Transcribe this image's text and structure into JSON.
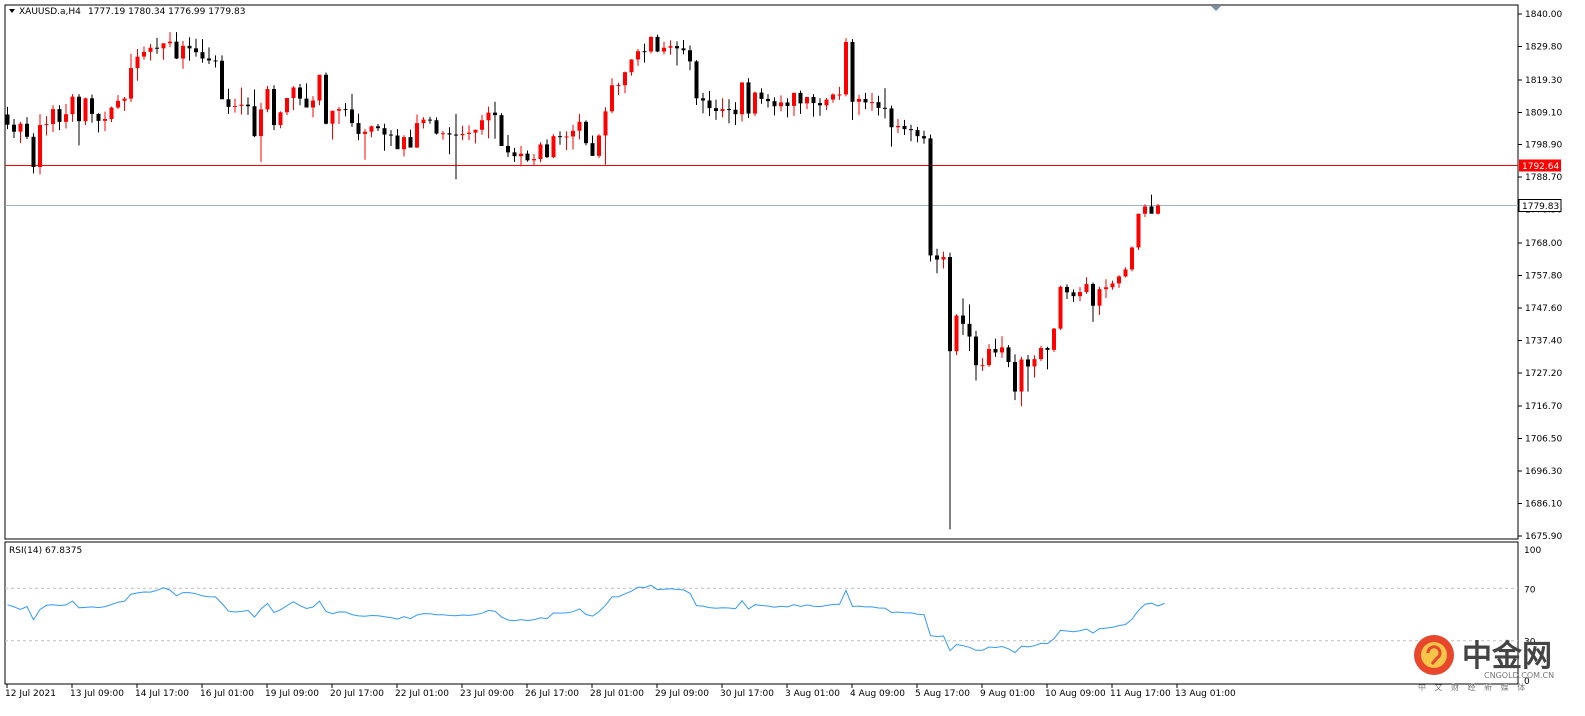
{
  "header": {
    "symbol": "XAUUSD.a,H4",
    "ohlc": "1777.19 1780.34 1776.99 1779.83"
  },
  "price_lines": {
    "resistance": {
      "value": 1792.64,
      "label": "1792.64",
      "color": "#ff0000"
    },
    "current": {
      "value": 1779.83,
      "label": "1779.83",
      "color": "#9fb1c5"
    }
  },
  "colors": {
    "bull": "#ff0000",
    "bear": "#000000",
    "rsi": "#3399ff",
    "frame": "#000000",
    "level": "#c0c0c0"
  },
  "rsi": {
    "label": "RSI(14) 67.8375",
    "scale_labels": [
      "100",
      "70",
      "30",
      "0"
    ],
    "levels": [
      30,
      70
    ]
  },
  "watermark": {
    "cn": "中金网",
    "url": "CNGOLD.COM.CN",
    "sub": "中 文 财 经 新 媒 体"
  },
  "chart_data": {
    "type": "candlestick",
    "title": "XAUUSD.a,H4",
    "ylim": [
      1675.9,
      1840.0
    ],
    "ytick_values": [
      1840.0,
      1829.8,
      1819.3,
      1809.1,
      1798.9,
      1788.7,
      1778.5,
      1768.0,
      1757.8,
      1747.6,
      1737.4,
      1727.2,
      1716.7,
      1706.5,
      1696.3,
      1686.1,
      1675.9
    ],
    "ytick_labels": [
      "1840.00",
      "1829.80",
      "1819.30",
      "1809.10",
      "1798.90",
      "1788.70",
      "1778.50",
      "1768.00",
      "1757.80",
      "1747.60",
      "1737.40",
      "1727.20",
      "1716.70",
      "1706.50",
      "1696.30",
      "1686.10",
      "1675.90"
    ],
    "xtick_labels": [
      "12 Jul 2021",
      "13 Jul 09:00",
      "14 Jul 17:00",
      "16 Jul 01:00",
      "19 Jul 09:00",
      "20 Jul 17:00",
      "22 Jul 01:00",
      "23 Jul 09:00",
      "26 Jul 17:00",
      "28 Jul 01:00",
      "29 Jul 09:00",
      "30 Jul 17:00",
      "3 Aug 01:00",
      "4 Aug 09:00",
      "5 Aug 17:00",
      "9 Aug 01:00",
      "10 Aug 09:00",
      "11 Aug 17:00",
      "13 Aug 01:00"
    ],
    "xtick_index": [
      0,
      10,
      20,
      30,
      40,
      50,
      60,
      70,
      80,
      90,
      100,
      110,
      120,
      130,
      140,
      150,
      160,
      170,
      180
    ],
    "candles": [
      [
        1808.4,
        1810.8,
        1803.8,
        1805.2
      ],
      [
        1805.2,
        1807.0,
        1801.0,
        1803.0
      ],
      [
        1803.0,
        1806.1,
        1799.4,
        1805.5
      ],
      [
        1805.5,
        1807.6,
        1800.7,
        1801.4
      ],
      [
        1801.4,
        1802.5,
        1789.9,
        1791.9
      ],
      [
        1791.9,
        1808.5,
        1789.6,
        1805.1
      ],
      [
        1805.1,
        1807.9,
        1801.8,
        1805.4
      ],
      [
        1805.4,
        1811.3,
        1802.9,
        1810.1
      ],
      [
        1810.1,
        1811.3,
        1803.5,
        1806.1
      ],
      [
        1806.1,
        1811.7,
        1804.0,
        1808.5
      ],
      [
        1808.5,
        1814.8,
        1806.1,
        1814.0
      ],
      [
        1814.0,
        1814.8,
        1798.7,
        1806.3
      ],
      [
        1806.3,
        1813.7,
        1805.1,
        1813.5
      ],
      [
        1813.5,
        1814.7,
        1805.8,
        1808.6
      ],
      [
        1808.6,
        1808.8,
        1802.8,
        1806.4
      ],
      [
        1806.4,
        1809.3,
        1803.2,
        1807.0
      ],
      [
        1807.0,
        1810.9,
        1806.0,
        1810.6
      ],
      [
        1810.6,
        1814.5,
        1810.1,
        1812.7
      ],
      [
        1812.7,
        1813.9,
        1809.5,
        1813.4
      ],
      [
        1813.4,
        1827.5,
        1812.3,
        1823.0
      ],
      [
        1823.0,
        1829.0,
        1819.0,
        1826.6
      ],
      [
        1826.6,
        1829.8,
        1825.6,
        1828.1
      ],
      [
        1828.1,
        1830.6,
        1825.4,
        1829.4
      ],
      [
        1829.4,
        1832.5,
        1827.5,
        1829.2
      ],
      [
        1829.2,
        1830.6,
        1825.6,
        1830.8
      ],
      [
        1830.8,
        1834.3,
        1829.6,
        1831.3
      ],
      [
        1831.3,
        1834.3,
        1825.8,
        1826.0
      ],
      [
        1826.0,
        1831.5,
        1822.8,
        1830.0
      ],
      [
        1830.0,
        1832.7,
        1825.3,
        1829.2
      ],
      [
        1829.2,
        1832.2,
        1826.6,
        1828.0
      ],
      [
        1828.0,
        1832.1,
        1824.7,
        1826.0
      ],
      [
        1826.0,
        1829.5,
        1824.3,
        1825.4
      ],
      [
        1825.4,
        1827.0,
        1823.2,
        1825.3
      ],
      [
        1825.3,
        1827.0,
        1813.7,
        1813.2
      ],
      [
        1813.2,
        1816.5,
        1808.6,
        1810.8
      ],
      [
        1810.8,
        1813.4,
        1809.0,
        1811.1
      ],
      [
        1811.1,
        1816.9,
        1808.4,
        1811.5
      ],
      [
        1811.5,
        1813.8,
        1808.3,
        1811.0
      ],
      [
        1811.0,
        1816.3,
        1801.3,
        1801.6
      ],
      [
        1801.6,
        1812.1,
        1793.5,
        1810.0
      ],
      [
        1810.0,
        1817.4,
        1809.1,
        1816.4
      ],
      [
        1816.4,
        1817.6,
        1803.5,
        1805.1
      ],
      [
        1805.1,
        1809.4,
        1804.1,
        1809.1
      ],
      [
        1809.1,
        1813.4,
        1808.2,
        1813.6
      ],
      [
        1813.6,
        1817.3,
        1809.8,
        1816.9
      ],
      [
        1816.9,
        1818.0,
        1811.3,
        1813.4
      ],
      [
        1813.4,
        1818.2,
        1811.1,
        1810.6
      ],
      [
        1810.6,
        1814.2,
        1807.5,
        1812.8
      ],
      [
        1812.8,
        1819.9,
        1811.3,
        1820.9
      ],
      [
        1820.9,
        1821.6,
        1805.3,
        1805.5
      ],
      [
        1805.5,
        1806.3,
        1800.5,
        1809.6
      ],
      [
        1809.6,
        1810.8,
        1805.4,
        1810.1
      ],
      [
        1810.1,
        1812.0,
        1807.8,
        1810.0
      ],
      [
        1810.0,
        1814.9,
        1804.5,
        1805.7
      ],
      [
        1805.7,
        1808.7,
        1800.3,
        1802.3
      ],
      [
        1802.3,
        1803.8,
        1794.2,
        1803.0
      ],
      [
        1803.0,
        1804.9,
        1801.2,
        1804.7
      ],
      [
        1804.7,
        1805.4,
        1803.2,
        1804.1
      ],
      [
        1804.1,
        1805.5,
        1797.0,
        1802.1
      ],
      [
        1802.1,
        1803.5,
        1798.5,
        1801.8
      ],
      [
        1801.8,
        1803.8,
        1797.8,
        1797.5
      ],
      [
        1797.5,
        1801.9,
        1795.2,
        1801.3
      ],
      [
        1801.3,
        1803.6,
        1799.6,
        1798.0
      ],
      [
        1798.0,
        1808.4,
        1797.9,
        1805.7
      ],
      [
        1805.7,
        1807.6,
        1804.0,
        1806.8
      ],
      [
        1806.8,
        1807.7,
        1805.5,
        1806.6
      ],
      [
        1806.6,
        1807.5,
        1802.1,
        1802.4
      ],
      [
        1802.4,
        1803.2,
        1800.5,
        1802.5
      ],
      [
        1802.5,
        1804.4,
        1795.9,
        1802.1
      ],
      [
        1802.1,
        1808.6,
        1788.0,
        1801.9
      ],
      [
        1801.9,
        1804.9,
        1800.3,
        1802.3
      ],
      [
        1802.3,
        1805.0,
        1800.3,
        1802.7
      ],
      [
        1802.7,
        1803.7,
        1799.3,
        1803.6
      ],
      [
        1803.6,
        1808.3,
        1802.0,
        1806.6
      ],
      [
        1806.6,
        1810.9,
        1800.9,
        1809.0
      ],
      [
        1809.0,
        1812.4,
        1800.8,
        1808.2
      ],
      [
        1808.2,
        1808.8,
        1800.6,
        1798.5
      ],
      [
        1798.5,
        1802.0,
        1795.1,
        1796.5
      ],
      [
        1796.5,
        1797.9,
        1793.5,
        1795.3
      ],
      [
        1795.3,
        1798.5,
        1792.1,
        1796.1
      ],
      [
        1796.1,
        1797.1,
        1793.6,
        1794.0
      ],
      [
        1794.0,
        1796.0,
        1792.5,
        1794.4
      ],
      [
        1794.4,
        1799.7,
        1793.4,
        1799.0
      ],
      [
        1799.0,
        1800.6,
        1794.7,
        1795.0
      ],
      [
        1795.0,
        1802.2,
        1794.7,
        1801.6
      ],
      [
        1801.6,
        1803.1,
        1798.9,
        1801.4
      ],
      [
        1801.4,
        1803.1,
        1797.2,
        1801.5
      ],
      [
        1801.5,
        1805.2,
        1797.4,
        1803.3
      ],
      [
        1803.3,
        1808.6,
        1800.6,
        1806.1
      ],
      [
        1806.1,
        1806.6,
        1798.7,
        1799.4
      ],
      [
        1799.4,
        1801.8,
        1795.4,
        1795.4
      ],
      [
        1795.4,
        1802.2,
        1794.7,
        1801.8
      ],
      [
        1801.8,
        1810.7,
        1792.6,
        1809.4
      ],
      [
        1809.4,
        1819.8,
        1808.8,
        1817.6
      ],
      [
        1817.6,
        1818.4,
        1814.5,
        1817.7
      ],
      [
        1817.6,
        1821.9,
        1815.1,
        1821.7
      ],
      [
        1821.7,
        1825.8,
        1820.6,
        1825.7
      ],
      [
        1825.7,
        1829.0,
        1823.7,
        1828.3
      ],
      [
        1828.3,
        1830.7,
        1824.7,
        1828.2
      ],
      [
        1828.2,
        1833.0,
        1827.6,
        1832.8
      ],
      [
        1832.8,
        1833.5,
        1828.0,
        1828.2
      ],
      [
        1828.2,
        1831.3,
        1827.3,
        1829.4
      ],
      [
        1829.4,
        1831.7,
        1827.2,
        1829.9
      ],
      [
        1829.9,
        1831.4,
        1823.8,
        1829.2
      ],
      [
        1829.2,
        1831.8,
        1827.3,
        1828.6
      ],
      [
        1828.6,
        1830.1,
        1822.3,
        1825.1
      ],
      [
        1825.1,
        1825.5,
        1811.4,
        1813.5
      ],
      [
        1813.5,
        1815.2,
        1808.8,
        1812.8
      ],
      [
        1812.8,
        1815.8,
        1807.9,
        1810.4
      ],
      [
        1810.4,
        1813.1,
        1806.7,
        1809.5
      ],
      [
        1809.5,
        1813.5,
        1807.5,
        1810.1
      ],
      [
        1810.1,
        1813.2,
        1805.6,
        1809.9
      ],
      [
        1809.9,
        1812.3,
        1805.1,
        1808.5
      ],
      [
        1808.5,
        1813.5,
        1806.2,
        1818.5
      ],
      [
        1818.5,
        1819.8,
        1807.3,
        1808.7
      ],
      [
        1808.7,
        1815.6,
        1807.9,
        1815.3
      ],
      [
        1815.3,
        1816.6,
        1811.8,
        1813.3
      ],
      [
        1813.3,
        1814.8,
        1810.6,
        1812.6
      ],
      [
        1812.6,
        1813.8,
        1808.1,
        1811.0
      ],
      [
        1811.0,
        1814.4,
        1809.4,
        1812.2
      ],
      [
        1812.2,
        1813.5,
        1807.5,
        1811.1
      ],
      [
        1811.1,
        1815.3,
        1807.9,
        1815.2
      ],
      [
        1815.2,
        1815.9,
        1808.6,
        1811.9
      ],
      [
        1811.9,
        1814.0,
        1810.1,
        1813.9
      ],
      [
        1813.9,
        1814.8,
        1807.7,
        1812.0
      ],
      [
        1812.0,
        1813.5,
        1808.0,
        1811.3
      ],
      [
        1811.3,
        1813.6,
        1809.8,
        1813.1
      ],
      [
        1813.1,
        1815.1,
        1812.1,
        1814.7
      ],
      [
        1814.7,
        1817.1,
        1813.0,
        1814.7
      ],
      [
        1814.7,
        1832.4,
        1814.1,
        1831.2
      ],
      [
        1831.2,
        1832.1,
        1806.7,
        1812.4
      ],
      [
        1812.4,
        1814.6,
        1808.3,
        1813.3
      ],
      [
        1813.3,
        1815.2,
        1810.1,
        1812.2
      ],
      [
        1812.2,
        1815.2,
        1809.6,
        1812.3
      ],
      [
        1812.3,
        1814.3,
        1808.1,
        1810.5
      ],
      [
        1810.5,
        1816.7,
        1807.2,
        1810.3
      ],
      [
        1810.3,
        1811.2,
        1798.3,
        1804.4
      ],
      [
        1804.4,
        1807.0,
        1802.6,
        1804.8
      ],
      [
        1804.8,
        1806.7,
        1802.0,
        1803.8
      ],
      [
        1803.8,
        1805.2,
        1800.0,
        1803.5
      ],
      [
        1803.5,
        1804.5,
        1799.7,
        1801.6
      ],
      [
        1801.6,
        1803.3,
        1799.2,
        1800.9
      ],
      [
        1800.9,
        1802.1,
        1762.2,
        1764.1
      ],
      [
        1764.1,
        1766.2,
        1758.5,
        1762.8
      ],
      [
        1762.8,
        1765.3,
        1760.0,
        1763.6
      ],
      [
        1763.6,
        1765.0,
        1678.0,
        1734.0
      ],
      [
        1734.0,
        1745.6,
        1732.8,
        1745.2
      ],
      [
        1745.2,
        1750.6,
        1739.1,
        1742.6
      ],
      [
        1742.6,
        1748.7,
        1734.0,
        1738.6
      ],
      [
        1738.6,
        1740.4,
        1724.8,
        1729.6
      ],
      [
        1729.6,
        1731.8,
        1727.8,
        1729.6
      ],
      [
        1729.6,
        1736.2,
        1729.1,
        1734.7
      ],
      [
        1734.7,
        1737.9,
        1732.2,
        1733.6
      ],
      [
        1733.6,
        1738.7,
        1731.9,
        1735.2
      ],
      [
        1735.2,
        1735.9,
        1729.0,
        1730.6
      ],
      [
        1730.6,
        1733.0,
        1718.6,
        1721.3
      ],
      [
        1721.3,
        1732.2,
        1716.7,
        1731.4
      ],
      [
        1731.4,
        1732.8,
        1721.3,
        1729.2
      ],
      [
        1729.2,
        1732.7,
        1725.7,
        1731.5
      ],
      [
        1731.5,
        1735.7,
        1730.9,
        1735.0
      ],
      [
        1735.0,
        1735.4,
        1728.3,
        1734.4
      ],
      [
        1734.4,
        1741.3,
        1733.8,
        1741.1
      ],
      [
        1741.1,
        1754.6,
        1740.7,
        1754.2
      ],
      [
        1754.2,
        1755.0,
        1750.4,
        1752.5
      ],
      [
        1752.5,
        1753.4,
        1749.5,
        1751.3
      ],
      [
        1751.3,
        1754.2,
        1749.7,
        1752.6
      ],
      [
        1752.6,
        1757.3,
        1752.0,
        1755.1
      ],
      [
        1755.1,
        1755.6,
        1743.2,
        1748.3
      ],
      [
        1748.3,
        1754.2,
        1745.4,
        1753.5
      ],
      [
        1753.5,
        1756.6,
        1750.7,
        1754.1
      ],
      [
        1754.1,
        1756.2,
        1753.3,
        1755.3
      ],
      [
        1755.3,
        1757.9,
        1753.9,
        1757.5
      ],
      [
        1757.5,
        1760.4,
        1757.2,
        1759.7
      ],
      [
        1759.7,
        1766.9,
        1759.1,
        1766.6
      ],
      [
        1766.6,
        1777.3,
        1765.8,
        1777.2
      ],
      [
        1777.2,
        1780.2,
        1776.2,
        1779.5
      ],
      [
        1779.5,
        1783.2,
        1777.8,
        1777.2
      ],
      [
        1777.2,
        1780.3,
        1777.0,
        1779.8
      ]
    ],
    "rsi_values": [
      57.5,
      55.8,
      53.8,
      56.1,
      45.9,
      53.8,
      57.0,
      57.4,
      56.9,
      57.3,
      60.2,
      55.1,
      55.4,
      55.8,
      55.3,
      56.0,
      57.6,
      59.4,
      60.1,
      65.5,
      66.5,
      67.2,
      67.1,
      68.5,
      70.4,
      68.6,
      64.3,
      66.7,
      66.7,
      65.8,
      64.2,
      63.6,
      63.4,
      58.4,
      52.5,
      51.9,
      52.3,
      53.1,
      48.0,
      54.2,
      58.4,
      51.5,
      53.6,
      56.8,
      59.7,
      56.7,
      54.6,
      55.7,
      60.2,
      52.3,
      50.6,
      52.0,
      51.9,
      49.9,
      48.9,
      48.7,
      49.2,
      49.1,
      48.3,
      47.6,
      46.5,
      48.3,
      46.9,
      49.6,
      50.7,
      50.5,
      49.8,
      49.8,
      49.2,
      49.0,
      49.6,
      49.3,
      49.9,
      51.0,
      53.1,
      52.5,
      48.2,
      45.8,
      45.3,
      46.1,
      45.4,
      46.0,
      47.5,
      46.8,
      51.2,
      51.1,
      51.2,
      52.1,
      54.3,
      50.0,
      48.8,
      52.2,
      57.0,
      63.4,
      63.6,
      65.8,
      67.8,
      70.9,
      70.5,
      72.3,
      69.0,
      69.3,
      69.6,
      69.1,
      68.8,
      66.2,
      56.8,
      56.4,
      55.3,
      54.7,
      55.2,
      55.0,
      54.4,
      60.5,
      54.1,
      57.5,
      56.9,
      56.5,
      55.6,
      56.3,
      55.8,
      57.5,
      56.1,
      57.3,
      56.3,
      56.0,
      56.9,
      57.7,
      57.7,
      68.4,
      56.1,
      56.4,
      55.8,
      55.8,
      55.0,
      54.9,
      51.5,
      51.8,
      51.3,
      51.2,
      50.2,
      49.9,
      33.8,
      33.2,
      33.6,
      22.4,
      27.1,
      26.2,
      25.0,
      22.7,
      22.7,
      25.2,
      24.8,
      25.6,
      23.8,
      20.9,
      25.8,
      25.3,
      26.2,
      28.0,
      27.8,
      31.6,
      37.9,
      37.4,
      36.9,
      37.6,
      38.9,
      35.9,
      39.2,
      39.6,
      40.3,
      41.5,
      42.4,
      46.4,
      53.2,
      57.9,
      58.6,
      56.6,
      58.5
    ]
  }
}
